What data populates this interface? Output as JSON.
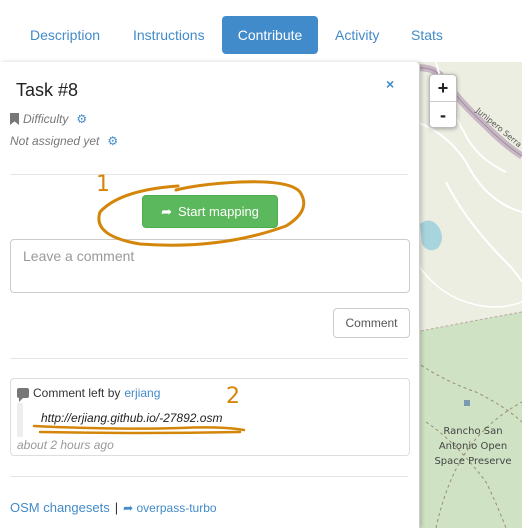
{
  "tabs": [
    {
      "label": "Description"
    },
    {
      "label": "Instructions"
    },
    {
      "label": "Contribute"
    },
    {
      "label": "Activity"
    },
    {
      "label": "Stats"
    }
  ],
  "task": {
    "title": "Task #8",
    "close_icon": "×",
    "difficulty_label": "Difficulty",
    "assignment_label": "Not assigned yet"
  },
  "actions": {
    "start_mapping_label": "Start mapping",
    "comment_placeholder": "Leave a comment",
    "comment_button_label": "Comment"
  },
  "comment": {
    "header_prefix": "Comment left by",
    "author": "erjiang",
    "text": "http://erjiang.github.io/-27892.osm",
    "time": "about 2 hours ago"
  },
  "links": {
    "changesets": "OSM changesets",
    "separator": "|",
    "overpass": "overpass-turbo"
  },
  "map": {
    "zoom_in": "+",
    "zoom_out": "-",
    "road_label": "Junipero Serra",
    "place_label": "Rancho San Antonio Open Space Preserve"
  },
  "annotations": {
    "one": "1",
    "two": "2",
    "color": "#d4860b"
  },
  "colors": {
    "accent": "#428bca",
    "success": "#5cb85c"
  }
}
